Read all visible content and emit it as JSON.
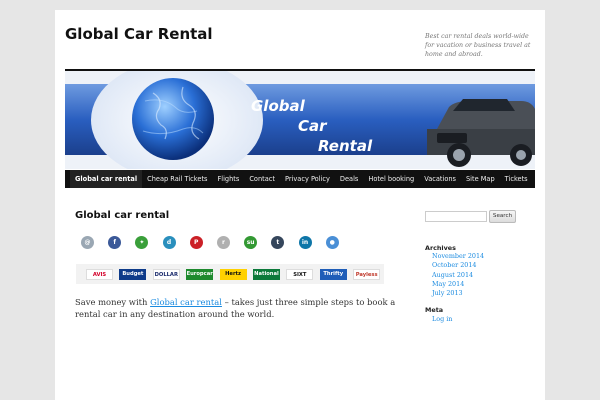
{
  "site": {
    "title": "Global Car Rental",
    "description": "Best car rental deals world-wide for vacation or business travel at home and abroad."
  },
  "banner": {
    "words": [
      "Global",
      "Car",
      "Rental"
    ],
    "colors": {
      "blue": "#2a5fc0",
      "dark": "#10306e"
    }
  },
  "nav": [
    "Global car rental",
    "Cheap Rail Tickets",
    "Flights",
    "Contact",
    "Privacy Policy",
    "Deals",
    "Hotel booking",
    "Vacations",
    "Site Map",
    "Tickets"
  ],
  "post": {
    "title": "Global car rental",
    "intro_before": "Save money with ",
    "intro_link": "Global car rental",
    "intro_after": " – takes just three simple steps to book a rental car in any destination around the world."
  },
  "social_icons": [
    {
      "name": "email-icon",
      "color": "#9aa7b3",
      "glyph": "@"
    },
    {
      "name": "facebook-icon",
      "color": "#3b5998",
      "glyph": "f"
    },
    {
      "name": "delicious-icon",
      "color": "#3a9f3a",
      "glyph": "✦"
    },
    {
      "name": "digg-icon",
      "color": "#2a8fbd",
      "glyph": "d"
    },
    {
      "name": "pinterest-icon",
      "color": "#cb2027",
      "glyph": "P"
    },
    {
      "name": "reddit-icon",
      "color": "#b0b0b0",
      "glyph": "r"
    },
    {
      "name": "stumbleupon-icon",
      "color": "#339933",
      "glyph": "su"
    },
    {
      "name": "tumblr-icon",
      "color": "#35465c",
      "glyph": "t"
    },
    {
      "name": "linkedin-icon",
      "color": "#0e76a8",
      "glyph": "in"
    },
    {
      "name": "share-icon",
      "color": "#4a8fd6",
      "glyph": "●"
    }
  ],
  "brands": [
    {
      "label": "AVIS",
      "bg": "#ffffff",
      "fg": "#d4002a"
    },
    {
      "label": "Budget",
      "bg": "#0e3b8a",
      "fg": "#ffffff"
    },
    {
      "label": "DOLLAR",
      "bg": "#ffffff",
      "fg": "#1a2a6c"
    },
    {
      "label": "Europcar",
      "bg": "#1e8a2e",
      "fg": "#ffffff"
    },
    {
      "label": "Hertz",
      "bg": "#ffd100",
      "fg": "#111111"
    },
    {
      "label": "National",
      "bg": "#0c7a3a",
      "fg": "#ffffff"
    },
    {
      "label": "SIXT",
      "bg": "#ffffff",
      "fg": "#111111"
    },
    {
      "label": "Thrifty",
      "bg": "#1f5db8",
      "fg": "#ffffff"
    },
    {
      "label": "Payless",
      "bg": "#ffffff",
      "fg": "#c0392b"
    }
  ],
  "sidebar": {
    "search_placeholder": "",
    "search_button": "Search",
    "archives_title": "Archives",
    "archives": [
      "November 2014",
      "October 2014",
      "August 2014",
      "May 2014",
      "July 2013"
    ],
    "meta_title": "Meta",
    "meta": [
      "Log in"
    ]
  }
}
